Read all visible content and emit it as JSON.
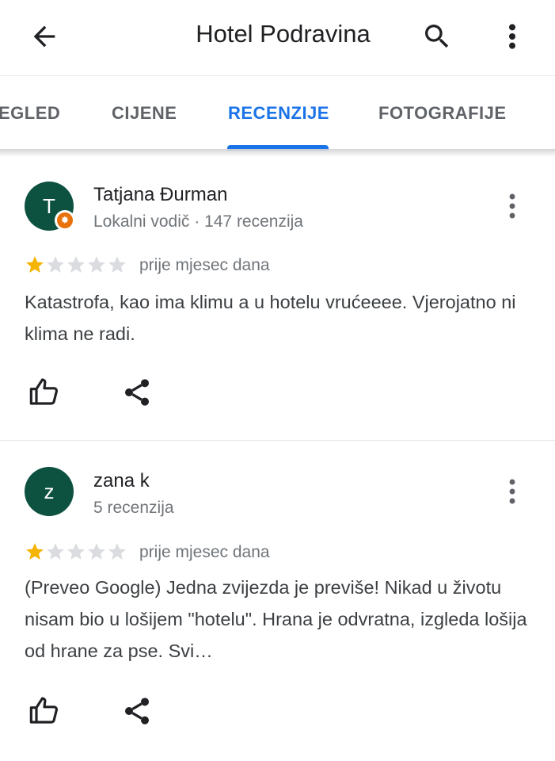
{
  "appbar": {
    "title": "Hotel Podravina",
    "back_icon": "arrow-back-icon",
    "search_icon": "search-icon",
    "more_icon": "more-vert-icon"
  },
  "tabs": [
    {
      "label": "EGLED",
      "active": false
    },
    {
      "label": "CIJENE",
      "active": false
    },
    {
      "label": "RECENZIJE",
      "active": true
    },
    {
      "label": "FOTOGRAFIJE",
      "active": false
    }
  ],
  "colors": {
    "accent": "#1a73e8",
    "avatar_bg": "#0d5240",
    "star_filled": "#f4b400",
    "star_empty": "#dadce0",
    "local_guide_badge": "#e8710a"
  },
  "reviews": [
    {
      "avatar_letter": "T",
      "local_guide": true,
      "author": "Tatjana Đurman",
      "meta": "Lokalni vodič · 147 recenzija",
      "rating": 1,
      "max_rating": 5,
      "date": "prije mjesec dana",
      "text": "Katastrofa, kao ima klimu a u hotelu vrućeeee. Vjerojatno ni klima ne radi."
    },
    {
      "avatar_letter": "z",
      "local_guide": false,
      "author": "zana k",
      "meta": "5 recenzija",
      "rating": 1,
      "max_rating": 5,
      "date": "prije mjesec dana",
      "text": "(Preveo Google) Jedna zvijezda je previše! Nikad u životu nisam bio u lošijem \"hotelu\". Hrana je odvratna, izgleda lošija od hrane za pse. Svi…"
    }
  ]
}
